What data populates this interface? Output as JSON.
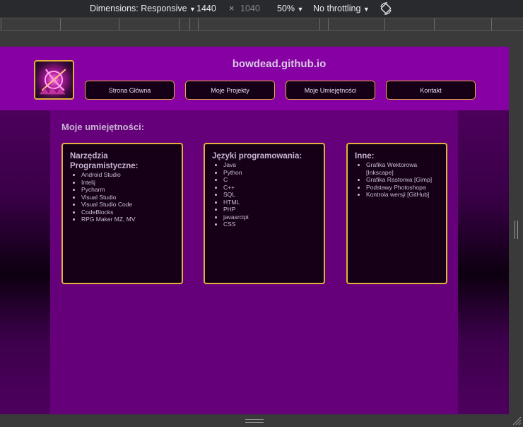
{
  "devtools": {
    "dimensions_label": "Dimensions: Responsive",
    "width": "1440",
    "times": "×",
    "height": "1040",
    "zoom": "50%",
    "throttling": "No throttling",
    "icons": [
      "chevron-down-icon",
      "rotate-icon",
      "resize-grip-icon"
    ]
  },
  "site": {
    "title": "bowdead.github.io",
    "nav": [
      "Strona Główna",
      "Moje Projekty",
      "Moje Umiejętności",
      "Kontakt"
    ],
    "section_title": "Moje umiejętności:",
    "cards": [
      {
        "title": "Narzędzia Programistyczne:",
        "items": [
          "Android Studio",
          "Intelij",
          "Pycharm",
          "Visual Studio",
          "Visual Studio Code",
          "CodeBlocks",
          "RPG Maker MZ, MV"
        ]
      },
      {
        "title": "Języki programowania:",
        "items": [
          "Java",
          "Python",
          "C",
          "C++",
          "SQL",
          "HTML",
          "PHP",
          "javasrcipt",
          "CSS"
        ]
      },
      {
        "title": "Inne:",
        "items": [
          "Grafika Wektorowa [Inkscape]",
          "Grafika Rastorwa [Gimp]",
          "Podstawy Photoshopa",
          "Kontrola wersji [GitHub]"
        ]
      }
    ]
  },
  "colors": {
    "header": "#8600a3",
    "content": "#66007a",
    "card_bg": "#150017",
    "border_gold": "#e1b13c"
  }
}
